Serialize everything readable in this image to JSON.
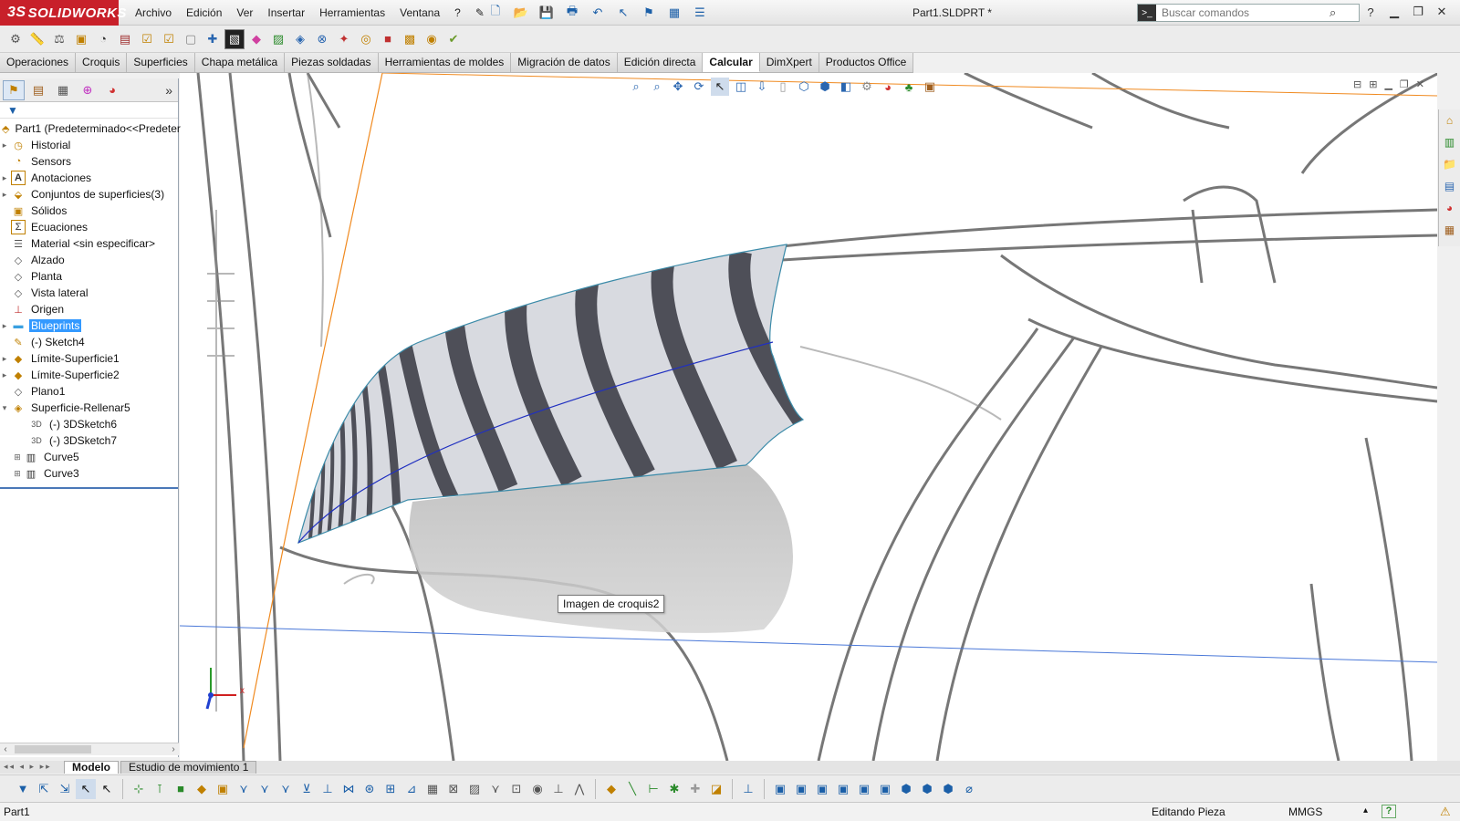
{
  "app": {
    "logo_text": "SOLIDWORKS",
    "logo_mark": "3S",
    "document_title": "Part1.SLDPRT *"
  },
  "menu": [
    "Archivo",
    "Edición",
    "Ver",
    "Insertar",
    "Herramientas",
    "Ventana",
    "?"
  ],
  "search": {
    "placeholder": "Buscar comandos"
  },
  "command_tabs": [
    {
      "label": "Operaciones"
    },
    {
      "label": "Croquis"
    },
    {
      "label": "Superficies"
    },
    {
      "label": "Chapa metálica"
    },
    {
      "label": "Piezas soldadas"
    },
    {
      "label": "Herramientas de moldes"
    },
    {
      "label": "Migración de datos"
    },
    {
      "label": "Edición directa"
    },
    {
      "label": "Calcular",
      "active": true
    },
    {
      "label": "DimXpert"
    },
    {
      "label": "Productos Office"
    }
  ],
  "tree": {
    "root": "Part1  (Predeterminado<<Predeter",
    "items": [
      {
        "label": "Historial",
        "icon": "history-icon"
      },
      {
        "label": "Sensors",
        "icon": "sensor-icon"
      },
      {
        "label": "Anotaciones",
        "icon": "annotations-icon"
      },
      {
        "label": "Conjuntos de superficies(3)",
        "icon": "surface-bodies-icon"
      },
      {
        "label": "Sólidos",
        "icon": "solid-bodies-icon"
      },
      {
        "label": "Ecuaciones",
        "icon": "equations-icon"
      },
      {
        "label": "Material <sin especificar>",
        "icon": "material-icon"
      },
      {
        "label": "Alzado",
        "icon": "plane-icon"
      },
      {
        "label": "Planta",
        "icon": "plane-icon"
      },
      {
        "label": "Vista lateral",
        "icon": "plane-icon"
      },
      {
        "label": "Origen",
        "icon": "origin-icon"
      },
      {
        "label": "Blueprints",
        "icon": "folder-icon",
        "selected": true
      },
      {
        "label": "(-) Sketch4",
        "icon": "sketch-icon"
      },
      {
        "label": "Límite-Superficie1",
        "icon": "boundary-surface-icon"
      },
      {
        "label": "Límite-Superficie2",
        "icon": "boundary-surface-icon"
      },
      {
        "label": "Plano1",
        "icon": "plane-icon"
      },
      {
        "label": "Superficie-Rellenar5",
        "icon": "fill-surface-icon"
      }
    ],
    "children": [
      {
        "label": "(-) 3DSketch6",
        "icon": "3dsketch-icon"
      },
      {
        "label": "(-) 3DSketch7",
        "icon": "3dsketch-icon"
      }
    ],
    "curves": [
      {
        "label": "Curve5",
        "icon": "curve-icon"
      },
      {
        "label": "Curve3",
        "icon": "curve-icon"
      }
    ]
  },
  "viewport": {
    "tooltip": "Imagen de croquis2",
    "triad_x": "x"
  },
  "bottom_tabs": [
    {
      "label": "Modelo",
      "active": true
    },
    {
      "label": "Estudio de movimiento 1"
    }
  ],
  "status": {
    "part": "Part1",
    "mode": "Editando Pieza",
    "units": "MMGS",
    "help": "?"
  }
}
